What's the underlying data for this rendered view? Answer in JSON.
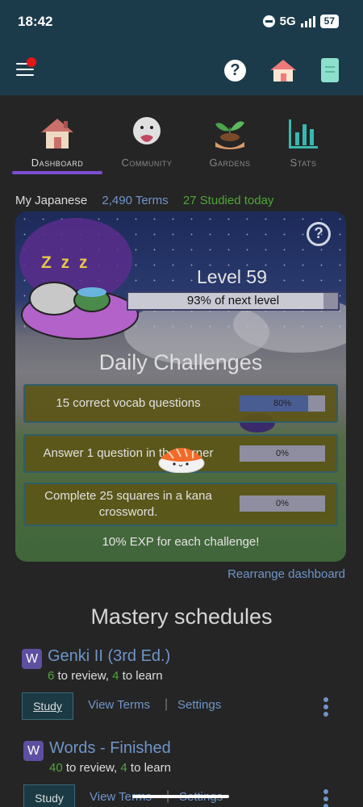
{
  "status_bar": {
    "time": "18:42",
    "network": "5G",
    "battery": "57"
  },
  "icons": {
    "menu": "hamburger-menu-icon",
    "help": "question-circle-icon",
    "home": "home-icon",
    "book": "book-icon"
  },
  "tabs": [
    {
      "label": "Dashboard",
      "icon": "house-icon",
      "active": true
    },
    {
      "label": "Community",
      "icon": "ghost-heart-icon",
      "active": false
    },
    {
      "label": "Gardens",
      "icon": "sprout-hand-icon",
      "active": false
    },
    {
      "label": "Stats",
      "icon": "bar-chart-icon",
      "active": false
    }
  ],
  "summary": {
    "language": "My Japanese",
    "terms": "2,490 Terms",
    "studied": "27 Studied today"
  },
  "hero": {
    "level": "Level 59",
    "level_progress_text": "93% of next level",
    "level_progress": 0.93,
    "daily_title": "Daily Challenges",
    "challenges": [
      {
        "text": "15 correct vocab questions",
        "pct": "80%",
        "value": 0.8
      },
      {
        "text": "Answer 1 question in the corner",
        "pct": "0%",
        "value": 0
      },
      {
        "text": "Complete 25 squares in a kana crossword.",
        "pct": "0%",
        "value": 0
      }
    ],
    "footer": "10% EXP for each challenge!"
  },
  "rearrange": "Rearrange dashboard",
  "mastery_title": "Mastery schedules",
  "decks": [
    {
      "badge": "W",
      "name": "Genki II (3rd Ed.)",
      "review": "6",
      "review_label": "to review,",
      "learn": "4",
      "learn_label": "to learn",
      "study": "Study",
      "view": "View Terms",
      "settings": "Settings"
    },
    {
      "badge": "W",
      "name": "Words - Finished",
      "review": "40",
      "review_label": "to review,",
      "learn": "4",
      "learn_label": "to learn",
      "study": "Study",
      "view": "View Terms",
      "settings": "Settings"
    }
  ],
  "colors": {
    "accent": "#7a4fd1",
    "link": "#6f95c9",
    "green": "#4ea63a",
    "header": "#1c3b4a"
  }
}
